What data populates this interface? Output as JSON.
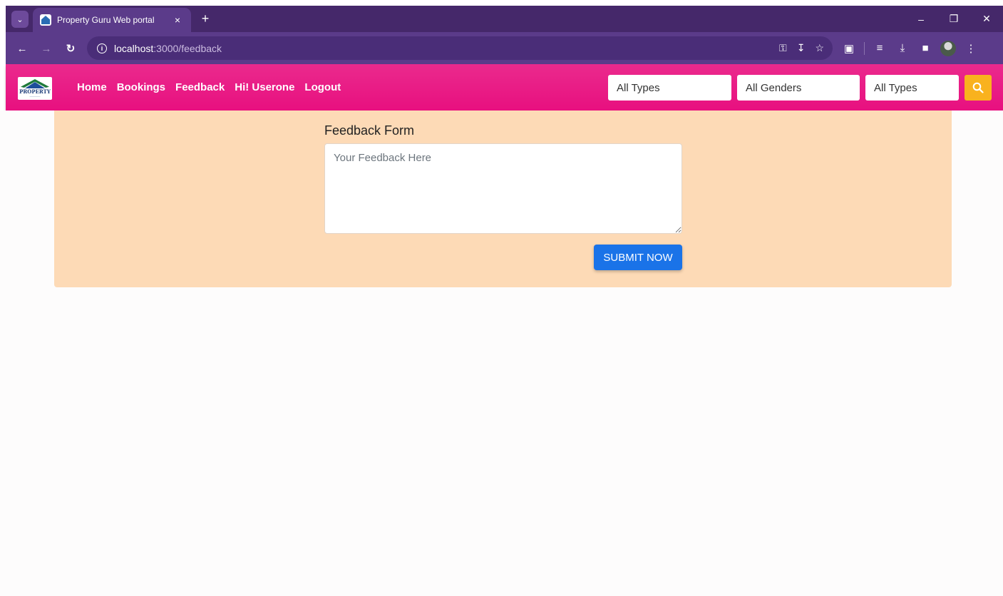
{
  "browser": {
    "tab_title": "Property Guru Web portal",
    "tab_close": "×",
    "new_tab": "+",
    "url_host": "localhost",
    "url_path": ":3000/feedback",
    "window_controls": [
      "–",
      "❐",
      "✕"
    ]
  },
  "site": {
    "logo_text": "PROPERTY",
    "nav": [
      "Home",
      "Bookings",
      "Feedback",
      "Hi! Userone",
      "Logout"
    ],
    "filters": [
      "All Types",
      "All Genders",
      "All Types"
    ],
    "colors": {
      "navbar": "#e8107f",
      "search_button": "#f9b21e",
      "panel": "#fddab6",
      "submit": "#1a73e8"
    }
  },
  "form": {
    "title": "Feedback Form",
    "placeholder": "Your Feedback Here",
    "value": "",
    "submit_label": "SUBMIT NOW"
  }
}
